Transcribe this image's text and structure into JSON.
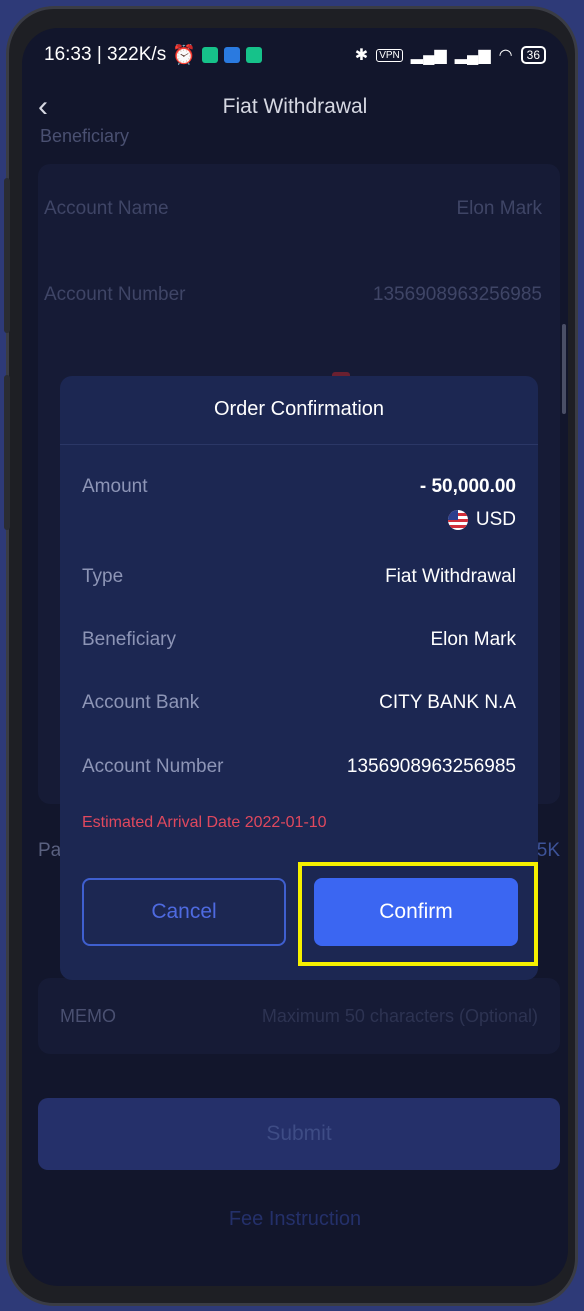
{
  "status_bar": {
    "time_speed": "16:33 | 322K/s",
    "battery": "36",
    "colors": {
      "alarm": "#ffffff",
      "app1": "#16c28a",
      "app2": "#2a7ae0",
      "app3": "#16c28a"
    }
  },
  "nav": {
    "title": "Fiat Withdrawal"
  },
  "background": {
    "section_label": "Beneficiary",
    "rows": [
      {
        "label": "Account Name",
        "value": "Elon Mark"
      },
      {
        "label": "Account Number",
        "value": "1356908963256985"
      }
    ],
    "pa_label": "Pa",
    "k_label": "5K",
    "memo": {
      "label": "MEMO",
      "placeholder": "Maximum 50 characters (Optional)"
    },
    "submit_label": "Submit",
    "fee_label": "Fee Instruction"
  },
  "modal": {
    "title": "Order Confirmation",
    "amount": {
      "label": "Amount",
      "value": "- 50,000.00",
      "currency": "USD"
    },
    "rows": [
      {
        "label": "Type",
        "value": "Fiat Withdrawal"
      },
      {
        "label": "Beneficiary",
        "value": "Elon Mark"
      },
      {
        "label": "Account Bank",
        "value": "CITY BANK N.A"
      },
      {
        "label": "Account Number",
        "value": "1356908963256985"
      }
    ],
    "estimated_arrival": "Estimated Arrival Date 2022-01-10",
    "cancel_label": "Cancel",
    "confirm_label": "Confirm"
  },
  "colors": {
    "accent": "#3b66f2",
    "highlight": "#f6f000",
    "warning_text": "#e0485e"
  }
}
